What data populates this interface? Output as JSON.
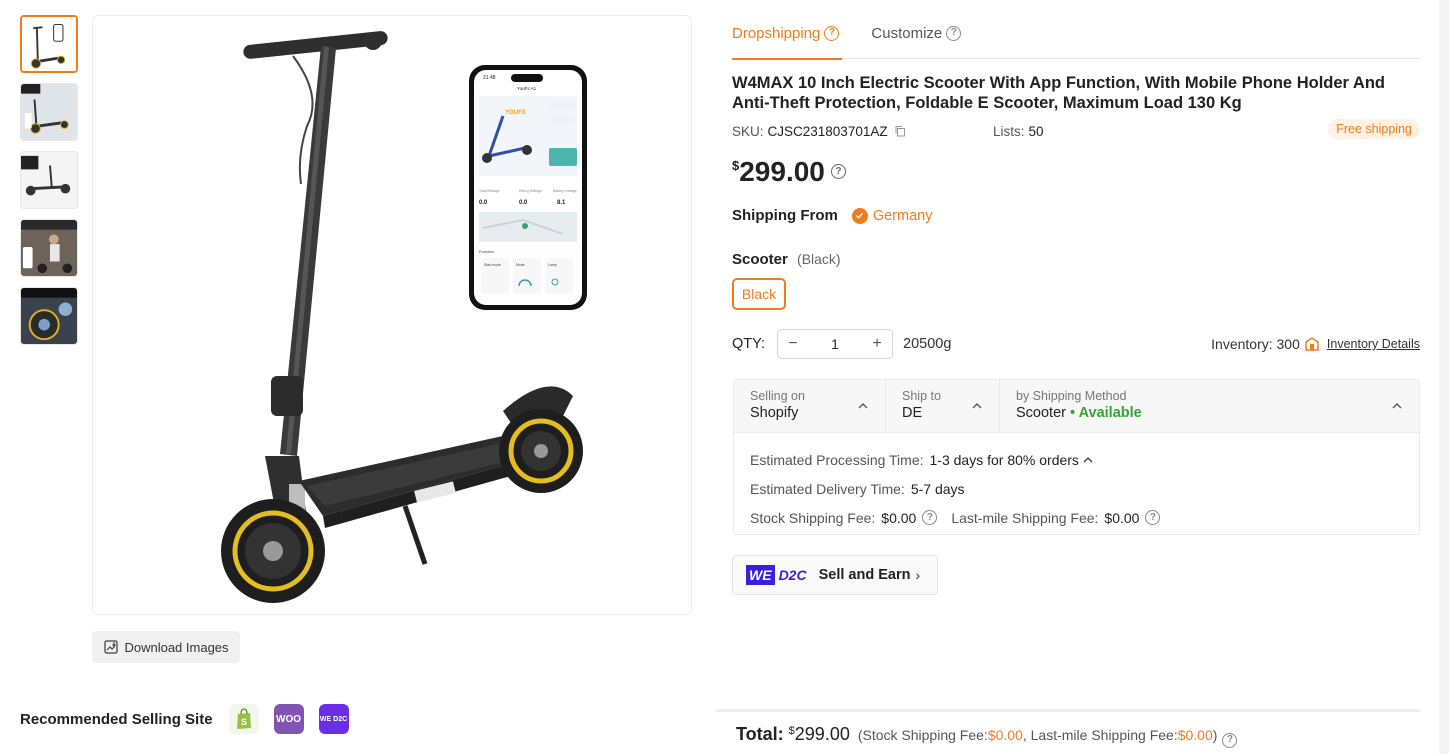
{
  "gallery": {
    "thumbnails": [
      "scooter-with-phone",
      "scooter-lifestyle",
      "scooter-side",
      "scooter-rider",
      "scooter-wheel-detail"
    ],
    "download_label": "Download Images"
  },
  "main_image": {
    "phone_app": {
      "time": "21:48",
      "device": "YouFs A1",
      "brand": "YOUFS",
      "stats": [
        {
          "label": "Total Mileage",
          "value": "0.0"
        },
        {
          "label": "Riding Mileage",
          "value": "0.0"
        },
        {
          "label": "Battery Voltage",
          "value": "8.1"
        }
      ],
      "function_label": "Function",
      "functions": [
        "Start mode",
        "Mode",
        "Lamp"
      ]
    }
  },
  "recommended": {
    "label": "Recommended Selling Site",
    "sites": [
      {
        "name": "shopify",
        "icon": "shopify-bag-icon",
        "color": "#95bf47"
      },
      {
        "name": "woo",
        "text": "WOO",
        "color": "#7f54b3"
      },
      {
        "name": "wed2c",
        "text": "WE D2C",
        "color": "#6a2ee8"
      }
    ]
  },
  "tabs": [
    {
      "label": "Dropshipping",
      "active": true
    },
    {
      "label": "Customize",
      "active": false
    }
  ],
  "product": {
    "title": "W4MAX 10 Inch Electric Scooter With App Function, With Mobile Phone Holder And Anti-Theft Protection, Foldable E Scooter, Maximum Load 130 Kg",
    "sku_label": "SKU:",
    "sku": "CJSC231803701AZ",
    "lists_label": "Lists:",
    "lists": "50",
    "free_shipping": "Free shipping",
    "currency": "$",
    "price": "299.00",
    "shipping_from_label": "Shipping From",
    "shipping_from": "Germany",
    "variant_label": "Scooter",
    "variant_selected": "(Black)",
    "variant_option": "Black",
    "qty_label": "QTY:",
    "qty": "1",
    "weight": "20500g",
    "inventory_label": "Inventory: 300",
    "inventory_details": "Inventory Details"
  },
  "shipping": {
    "selling_on_label": "Selling on",
    "selling_on": "Shopify",
    "ship_to_label": "Ship to",
    "ship_to": "DE",
    "method_label": "by Shipping Method",
    "method": "Scooter",
    "availability": "• Available",
    "processing_label": "Estimated Processing Time:",
    "processing": "1-3 days for 80% orders",
    "delivery_label": "Estimated Delivery Time:",
    "delivery": "5-7 days",
    "stock_fee_label": "Stock Shipping Fee:",
    "stock_fee": "$0.00",
    "lastmile_fee_label": "Last-mile Shipping Fee:",
    "lastmile_fee": "$0.00"
  },
  "wed2c": {
    "we": "WE",
    "d2c": "D2C",
    "label": "Sell and Earn"
  },
  "total": {
    "label": "Total:",
    "currency": "$",
    "amount": "299.00",
    "open": "(Stock Shipping Fee: ",
    "stock_fee": "$0.00",
    "mid": ", Last-mile Shipping Fee: ",
    "lastmile_fee": "$0.00",
    "close": ")"
  },
  "colors": {
    "accent": "#f07c1b",
    "available": "#3aa03a",
    "wed2c": "#3b1fe0"
  }
}
